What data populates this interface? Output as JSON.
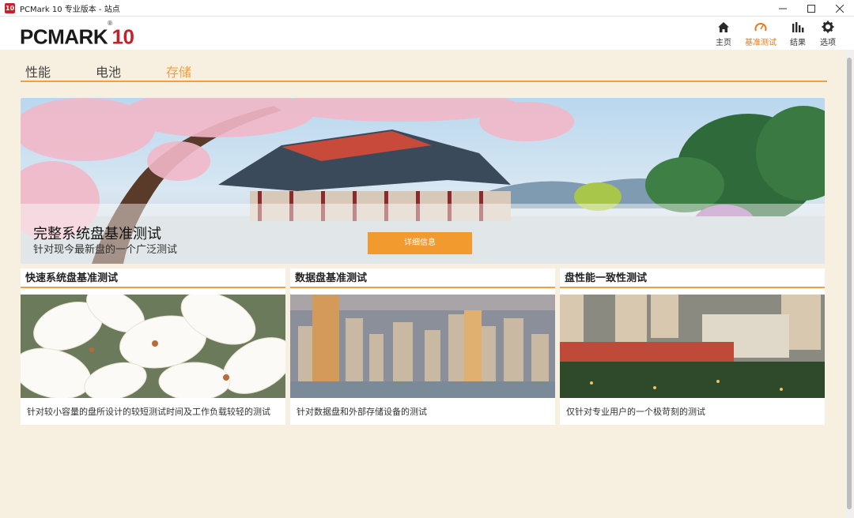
{
  "window": {
    "title": "PCMark 10 专业版本 - 站点",
    "app_icon_text": "10"
  },
  "header": {
    "logo_main": "PCMARK",
    "logo_num": "10",
    "logo_mark": "®",
    "nav": [
      {
        "label": "主页",
        "icon": "home-icon"
      },
      {
        "label": "基准测试",
        "icon": "gauge-icon",
        "active": true
      },
      {
        "label": "结果",
        "icon": "bar-chart-icon"
      },
      {
        "label": "选项",
        "icon": "gear-icon"
      }
    ]
  },
  "tabs": [
    {
      "label": "性能"
    },
    {
      "label": "电池"
    },
    {
      "label": "存储",
      "active": true
    }
  ],
  "hero": {
    "title": "完整系统盘基准测试",
    "subtitle": "针对现今最新盘的一个广泛测试",
    "button": "详细信息"
  },
  "cards": [
    {
      "title": "快速系统盘基准测试",
      "desc": "针对较小容量的盘所设计的较短测试时间及工作负载较轻的测试"
    },
    {
      "title": "数据盘基准测试",
      "desc": "针对数据盘和外部存储设备的测试"
    },
    {
      "title": "盘性能一致性测试",
      "desc": "仅针对专业用户的一个极苛刻的测试"
    }
  ],
  "colors": {
    "accent": "#f0a040",
    "button": "#f29a2e",
    "brand_red": "#c8202a",
    "background": "#f7efe0"
  }
}
